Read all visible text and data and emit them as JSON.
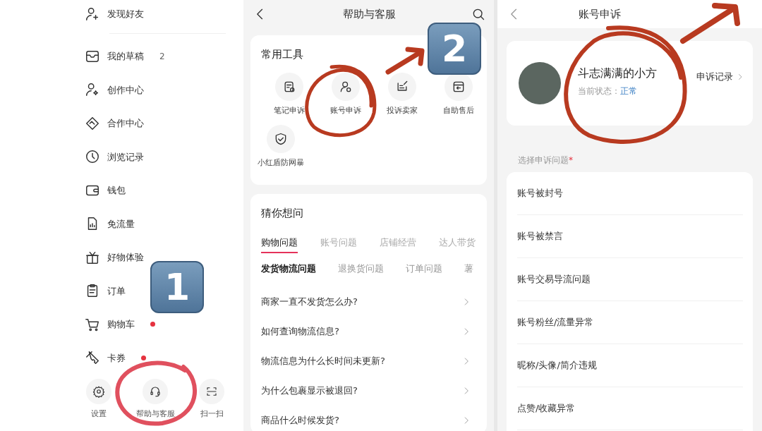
{
  "menu": {
    "items": [
      {
        "label": "发现好友",
        "dot": false
      },
      {
        "label": "我的草稿",
        "count": "2",
        "dot": false
      },
      {
        "label": "创作中心",
        "dot": false
      },
      {
        "label": "合作中心",
        "dot": false
      },
      {
        "label": "浏览记录",
        "dot": false
      },
      {
        "label": "钱包",
        "dot": false
      },
      {
        "label": "免流量",
        "dot": false
      },
      {
        "label": "好物体验",
        "dot": false
      },
      {
        "label": "订单",
        "dot": false
      },
      {
        "label": "购物车",
        "dot": true
      },
      {
        "label": "卡券",
        "dot": true
      }
    ],
    "bottom_actions": [
      {
        "label": "设置"
      },
      {
        "label": "帮助与客服"
      },
      {
        "label": "扫一扫"
      }
    ]
  },
  "help_page": {
    "title": "帮助与客服",
    "tools_card": {
      "title": "常用工具",
      "tools": [
        {
          "label": "笔记申诉"
        },
        {
          "label": "账号申诉"
        },
        {
          "label": "投诉卖家"
        },
        {
          "label": "自助售后"
        },
        {
          "label": "小红盾防网暴"
        }
      ]
    },
    "faq_card": {
      "title": "猜你想问",
      "tabs": [
        {
          "label": "购物问题",
          "selected": true
        },
        {
          "label": "账号问题",
          "selected": false
        },
        {
          "label": "店铺经营",
          "selected": false
        },
        {
          "label": "达人带货",
          "selected": false
        }
      ],
      "subtabs": [
        {
          "label": "发货物流问题",
          "selected": true
        },
        {
          "label": "退换货问题",
          "selected": false
        },
        {
          "label": "订单问题",
          "selected": false
        },
        {
          "label": "薯",
          "selected": false
        }
      ],
      "questions": [
        "商家一直不发货怎么办?",
        "如何查询物流信息?",
        "物流信息为什么长时间未更新?",
        "为什么包裹显示被退回?",
        "商品什么时候发货?"
      ]
    }
  },
  "appeal_page": {
    "title": "账号申诉",
    "profile": {
      "name": "斗志满满的小方",
      "status_label": "当前状态：",
      "status_value": "正常",
      "records_link": "申诉记录"
    },
    "section_label": "选择申诉问题",
    "required_mark": "*",
    "issues": [
      "账号被封号",
      "账号被禁言",
      "账号交易导流问题",
      "账号粉丝/流量异常",
      "昵称/头像/简介违规",
      "点赞/收藏异常"
    ]
  },
  "annotations": [
    {
      "label": "1"
    },
    {
      "label": "2"
    }
  ]
}
